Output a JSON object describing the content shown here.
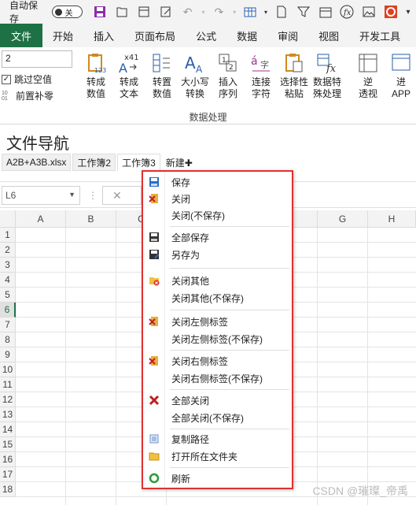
{
  "qat": {
    "autosave_label": "自动保存",
    "toggle_text": "关"
  },
  "ribbon_tabs": [
    "文件",
    "开始",
    "插入",
    "页面布局",
    "公式",
    "数据",
    "审阅",
    "视图",
    "开发工具"
  ],
  "ribbon": {
    "input_value": "2",
    "skip_blank_label": "跳过空值",
    "prefix_fill_label": "前置补零",
    "prefix_mini_text": "10 01",
    "buttons": [
      {
        "label": "转成\n数值",
        "icon": "clipboard-123-icon"
      },
      {
        "label": "转成\n文本",
        "icon": "text-x41-icon"
      },
      {
        "label": "转置\n数值",
        "icon": "transpose-icon"
      },
      {
        "label": "大小写\n转换",
        "icon": "case-icon"
      },
      {
        "label": "插入\n序列",
        "icon": "sequence-icon"
      },
      {
        "label": "连接\n字符",
        "icon": "join-chars-icon"
      },
      {
        "label": "选择性\n粘贴",
        "icon": "paste-special-icon"
      },
      {
        "label": "数据特\n殊处理",
        "icon": "data-special-icon"
      },
      {
        "label": "逆\n透视",
        "icon": "unpivot-icon"
      },
      {
        "label": "进\nAPP",
        "icon": "app-icon"
      }
    ],
    "group_label": "数据处理"
  },
  "nav": {
    "title": "文件导航",
    "doc_tabs": [
      "A2B+A3B.xlsx",
      "工作簿2",
      "工作簿3"
    ],
    "new_label": "新建✚"
  },
  "formula_bar": {
    "namebox": "L6",
    "dots": "⋮",
    "cancel": "✕"
  },
  "grid": {
    "columns": [
      "A",
      "B",
      "C",
      "G",
      "H"
    ],
    "rows": [
      "1",
      "2",
      "3",
      "4",
      "5",
      "6",
      "7",
      "8",
      "9",
      "10",
      "11",
      "12",
      "13",
      "14",
      "15",
      "16",
      "17",
      "18"
    ],
    "selected_row": "6"
  },
  "context_menu": {
    "items": [
      {
        "label": "保存",
        "icon": "save-icon"
      },
      {
        "label": "关闭",
        "icon": "close-book-icon"
      },
      {
        "label": "关闭(不保存)",
        "icon": ""
      },
      {
        "label": "全部保存",
        "icon": "save-all-icon"
      },
      {
        "label": "另存为",
        "icon": "save-as-icon"
      },
      {
        "label": "关闭其他",
        "icon": "folder-close-icon"
      },
      {
        "label": "关闭其他(不保存)",
        "icon": ""
      },
      {
        "label": "关闭左侧标签",
        "icon": "close-left-icon"
      },
      {
        "label": "关闭左侧标签(不保存)",
        "icon": ""
      },
      {
        "label": "关闭右侧标签",
        "icon": "close-right-icon"
      },
      {
        "label": "关闭右侧标签(不保存)",
        "icon": ""
      },
      {
        "label": "全部关闭",
        "icon": "close-all-icon"
      },
      {
        "label": "全部关闭(不保存)",
        "icon": ""
      },
      {
        "label": "复制路径",
        "icon": "copy-path-icon"
      },
      {
        "label": "打开所在文件夹",
        "icon": "open-folder-icon"
      },
      {
        "label": "刷新",
        "icon": "refresh-icon"
      }
    ]
  },
  "colors": {
    "file_tab": "#1e7145",
    "menu_border": "#e03030"
  },
  "watermark": "CSDN @璀璨_帝禹"
}
